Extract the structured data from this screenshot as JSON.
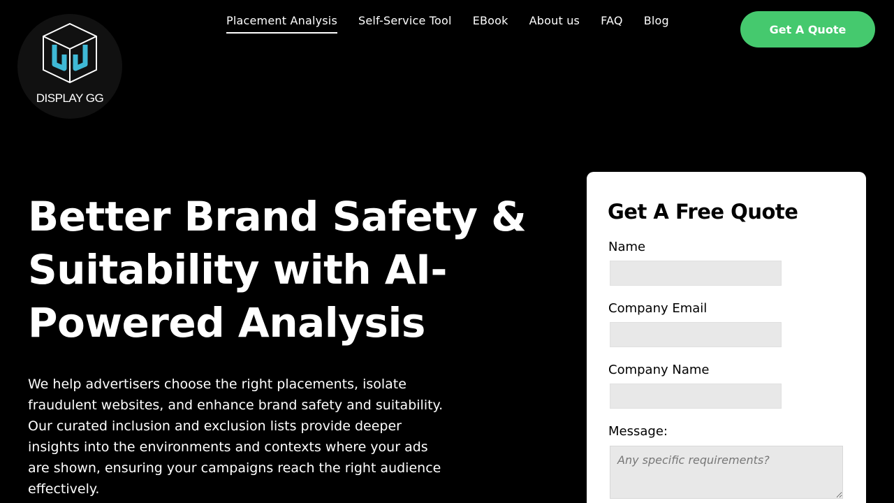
{
  "brand": {
    "logo_text": "DISPLAY GG",
    "logo_icon": "cube-logo-icon",
    "accent_color": "#45c96e",
    "logo_color": "#3fb9d6"
  },
  "nav": {
    "items": [
      {
        "label": "Placement Analysis",
        "active": true
      },
      {
        "label": "Self-Service Tool",
        "active": false
      },
      {
        "label": "EBook",
        "active": false
      },
      {
        "label": "About us",
        "active": false
      },
      {
        "label": "FAQ",
        "active": false
      },
      {
        "label": "Blog",
        "active": false
      }
    ],
    "cta_label": "Get A Quote"
  },
  "hero": {
    "title": "Better Brand Safety & Suitability with AI-Powered Analysis",
    "description": "We help advertisers choose the right placements, isolate fraudulent websites, and enhance brand safety and suitability. Our curated inclusion and exclusion lists provide deeper insights into the environments and contexts where your ads are shown, ensuring your campaigns reach the right audience effectively."
  },
  "form": {
    "title": "Get A Free Quote",
    "name_label": "Name",
    "name_value": "",
    "email_label": "Company Email",
    "email_value": "",
    "company_label": "Company Name",
    "company_value": "",
    "message_label": "Message:",
    "message_placeholder": "Any specific requirements?"
  }
}
